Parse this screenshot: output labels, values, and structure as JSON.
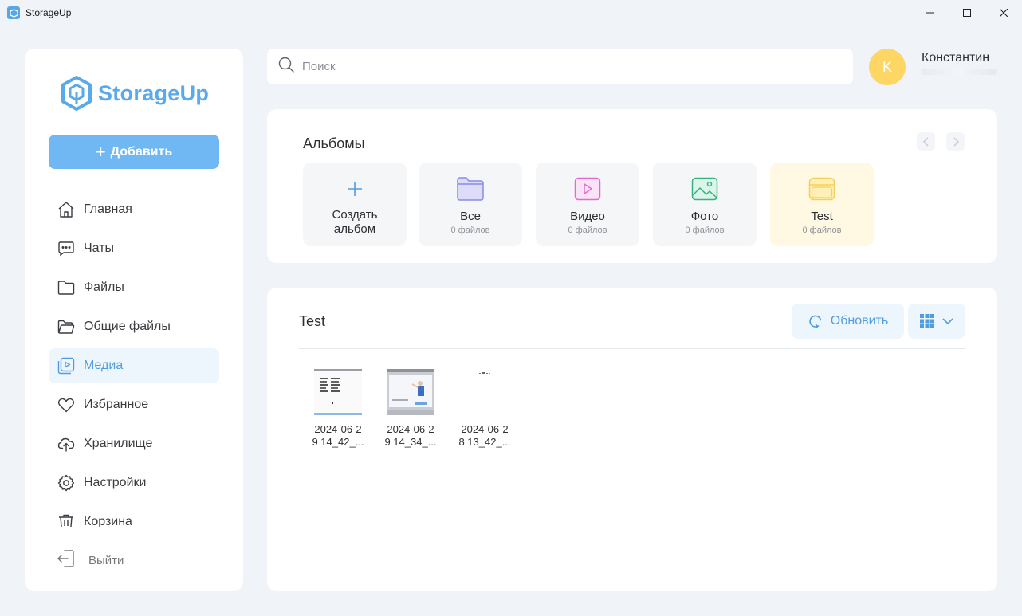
{
  "window": {
    "title": "StorageUp"
  },
  "sidebar": {
    "logo_text": "StorageUp",
    "add_label": "Добавить",
    "items": [
      {
        "label": "Главная",
        "icon": "home-icon"
      },
      {
        "label": "Чаты",
        "icon": "chat-icon"
      },
      {
        "label": "Файлы",
        "icon": "folder-icon"
      },
      {
        "label": "Общие файлы",
        "icon": "shared-folder-icon"
      },
      {
        "label": "Медиа",
        "icon": "media-icon",
        "active": true
      },
      {
        "label": "Избранное",
        "icon": "heart-icon"
      },
      {
        "label": "Хранилище",
        "icon": "cloud-upload-icon"
      },
      {
        "label": "Настройки",
        "icon": "gear-icon"
      },
      {
        "label": "Корзина",
        "icon": "trash-icon"
      }
    ],
    "logout_label": "Выйти"
  },
  "search": {
    "placeholder": "Поиск"
  },
  "user": {
    "initial": "K",
    "name": "Константин"
  },
  "albums": {
    "title": "Альбомы",
    "create_label": "Создать альбом",
    "items": [
      {
        "name": "Все",
        "count": "0 файлов",
        "icon": "folder-icon"
      },
      {
        "name": "Видео",
        "count": "0 файлов",
        "icon": "video-icon"
      },
      {
        "name": "Фото",
        "count": "0 файлов",
        "icon": "image-icon"
      },
      {
        "name": "Test",
        "count": "0 файлов",
        "icon": "album-icon"
      }
    ]
  },
  "media": {
    "title": "Test",
    "refresh_label": "Обновить",
    "files": [
      {
        "name": "2024-06-2\n9 14_42_..."
      },
      {
        "name": "2024-06-2\n9 14_34_..."
      },
      {
        "name": "2024-06-2\n8 13_42_..."
      }
    ]
  },
  "colors": {
    "accent": "#70b8f3",
    "accent_text": "#4f9de0",
    "avatar": "#fdd663",
    "test_album_bg": "#fff8e3"
  }
}
